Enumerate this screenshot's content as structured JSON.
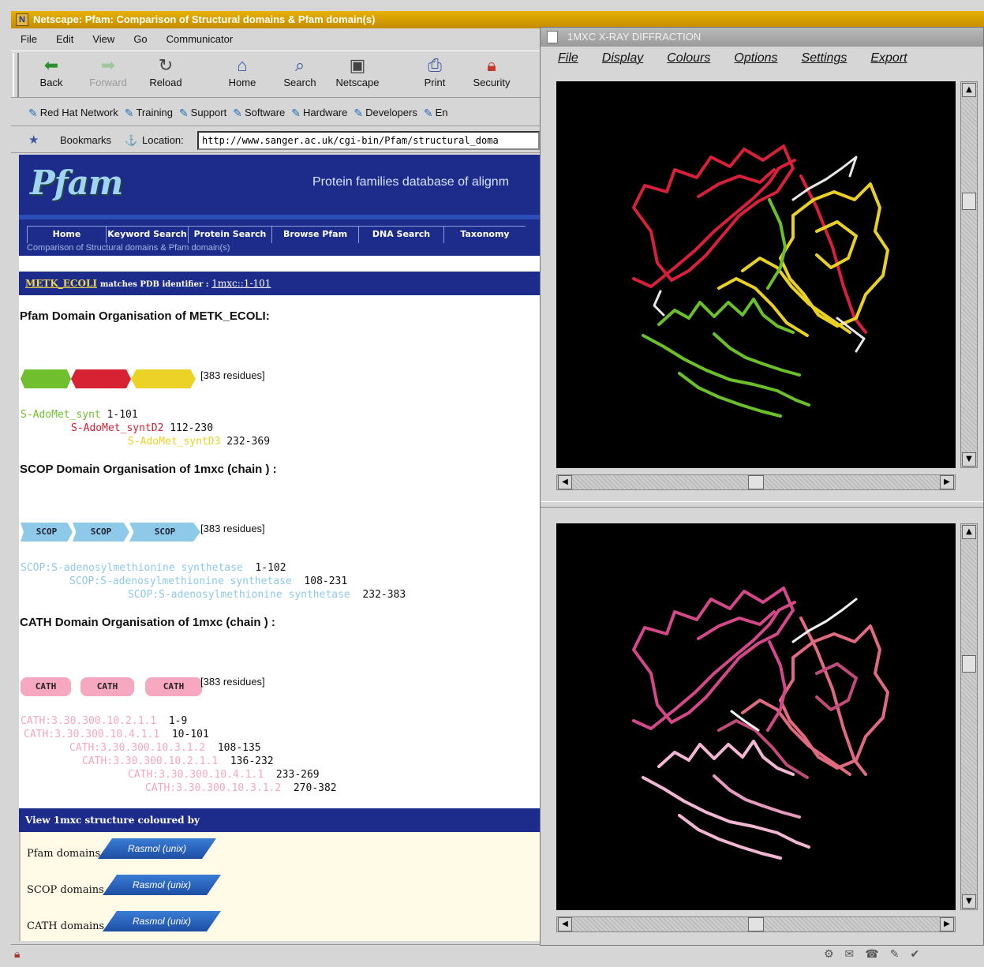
{
  "netscape": {
    "title": "Netscape: Pfam: Comparison of Structural domains & Pfam domain(s)",
    "menu": [
      "File",
      "Edit",
      "View",
      "Go",
      "Communicator"
    ],
    "toolbar": [
      {
        "label": "Back",
        "icon": "back-arrow-icon",
        "disabled": false
      },
      {
        "label": "Forward",
        "icon": "forward-arrow-icon",
        "disabled": true
      },
      {
        "label": "Reload",
        "icon": "reload-icon",
        "disabled": false
      },
      {
        "label": "Home",
        "icon": "home-icon",
        "disabled": false
      },
      {
        "label": "Search",
        "icon": "search-icon",
        "disabled": false
      },
      {
        "label": "Netscape",
        "icon": "netscape-icon",
        "disabled": false
      },
      {
        "label": "Print",
        "icon": "print-icon",
        "disabled": false
      },
      {
        "label": "Security",
        "icon": "lock-icon",
        "disabled": false
      }
    ],
    "personal_toolbar": [
      "Red Hat Network",
      "Training",
      "Support",
      "Software",
      "Hardware",
      "Developers",
      "En"
    ],
    "bookmarks_label": "Bookmarks",
    "location_label": "Location:",
    "location_value": "http://www.sanger.ac.uk/cgi-bin/Pfam/structural_doma"
  },
  "pfam": {
    "logo": "Pfam",
    "tagline": "Protein families database of alignm",
    "nav": [
      "Home",
      "Keyword Search",
      "Protein Search",
      "Browse Pfam",
      "DNA Search",
      "Taxonomy"
    ],
    "subtitle": "Comparison of Structural domains & Pfam domain(s)",
    "match": {
      "protein": "METK_ECOLI",
      "text": "matches PDB identifier :",
      "pdb": "1mxc::1-101"
    },
    "pfam_section": {
      "title": "Pfam Domain Organisation of METK_ECOLI:",
      "residues": "[383 residues]",
      "domains": [
        {
          "name": "S-AdoMet_synt",
          "range": "1-101",
          "color": "#6fbf2e"
        },
        {
          "name": "S-AdoMet_syntD2",
          "range": "112-230",
          "color": "#d62232"
        },
        {
          "name": "S-AdoMet_syntD3",
          "range": "232-369",
          "color": "#ecd226"
        }
      ]
    },
    "scop_section": {
      "title": "SCOP Domain Organisation of 1mxc (chain ) :",
      "residues": "[383 residues]",
      "box_label": "SCOP",
      "domains": [
        {
          "name": "SCOP:S-adenosylmethionine synthetase",
          "range": "1-102"
        },
        {
          "name": "SCOP:S-adenosylmethionine synthetase",
          "range": "108-231"
        },
        {
          "name": "SCOP:S-adenosylmethionine synthetase",
          "range": "232-383"
        }
      ]
    },
    "cath_section": {
      "title": "CATH Domain Organisation of 1mxc (chain ) :",
      "residues": "[383 residues]",
      "box_label": "CATH",
      "domains": [
        {
          "name": "CATH:3.30.300.10.2.1.1",
          "range": "1-9"
        },
        {
          "name": "CATH:3.30.300.10.4.1.1",
          "range": "10-101"
        },
        {
          "name": "CATH:3.30.300.10.3.1.2",
          "range": "108-135"
        },
        {
          "name": "CATH:3.30.300.10.2.1.1",
          "range": "136-232"
        },
        {
          "name": "CATH:3.30.300.10.4.1.1",
          "range": "233-269"
        },
        {
          "name": "CATH:3.30.300.10.3.1.2",
          "range": "270-382"
        }
      ]
    },
    "view_section": {
      "title": "View 1mxc structure coloured by",
      "rows": [
        {
          "label": "Pfam domains",
          "button": "Rasmol (unix)"
        },
        {
          "label": "SCOP domains",
          "button": "Rasmol (unix)"
        },
        {
          "label": "CATH domains",
          "button": "Rasmol (unix)"
        }
      ]
    }
  },
  "rasmol": {
    "title": "1MXC X-RAY DIFFRACTION",
    "menu": [
      "File",
      "Display",
      "Colours",
      "Options",
      "Settings",
      "Export"
    ]
  },
  "colors": {
    "pfam_blue": "#1d2c8a",
    "netscape_title": "#d9a000",
    "scop": "#8fc9ea",
    "cath": "#f5a8c0"
  }
}
